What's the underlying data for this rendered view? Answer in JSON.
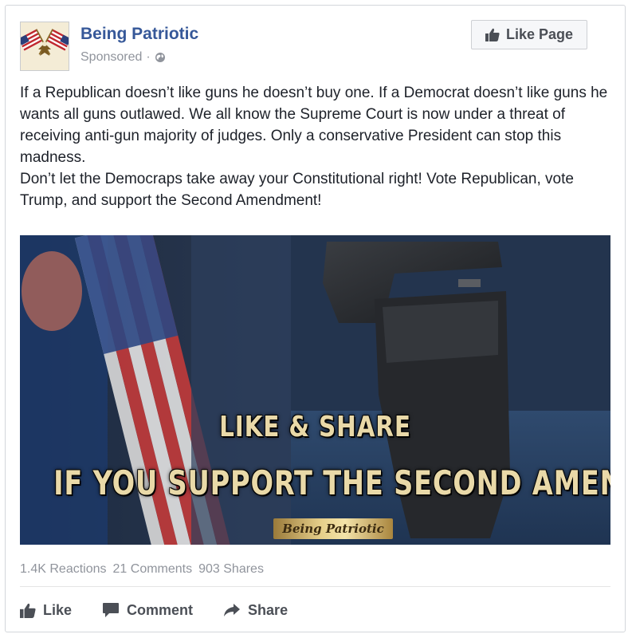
{
  "post": {
    "page_name": "Being Patriotic",
    "sponsored_label": "Sponsored",
    "meta_separator": "·",
    "like_page_label": "Like Page",
    "text_paragraphs": [
      "If a Republican doesn’t like guns he doesn’t buy one. If a Democrat doesn’t like guns he wants all guns outlawed. We all know the Supreme Court is now under a threat of receiving anti-gun majority of judges. Only a conservative President can stop this madness.",
      "Don’t let the Democraps take away your Constitutional right! Vote Republican, vote Trump, and support the Second Amendment!"
    ],
    "image": {
      "caption_line1": "LIKE & SHARE",
      "caption_line2": "IF YOU SUPPORT THE SECOND AMENDMENT",
      "watermark": "Being Patriotic"
    }
  },
  "stats": {
    "reactions": "1.4K Reactions",
    "comments": "21 Comments",
    "shares": "903 Shares"
  },
  "actions": {
    "like_label": "Like",
    "comment_label": "Comment",
    "share_label": "Share"
  },
  "icons": {
    "avatar": "crossed-flags-eagle-icon",
    "privacy": "globe-icon",
    "like_page": "thumbs-up-icon",
    "like": "thumbs-up-icon",
    "comment": "speech-bubble-icon",
    "share": "share-arrow-icon"
  },
  "colors": {
    "link_blue": "#365899",
    "meta_gray": "#90949c",
    "action_gray": "#4b4f56",
    "caption_gold": "#e9d9a8"
  }
}
